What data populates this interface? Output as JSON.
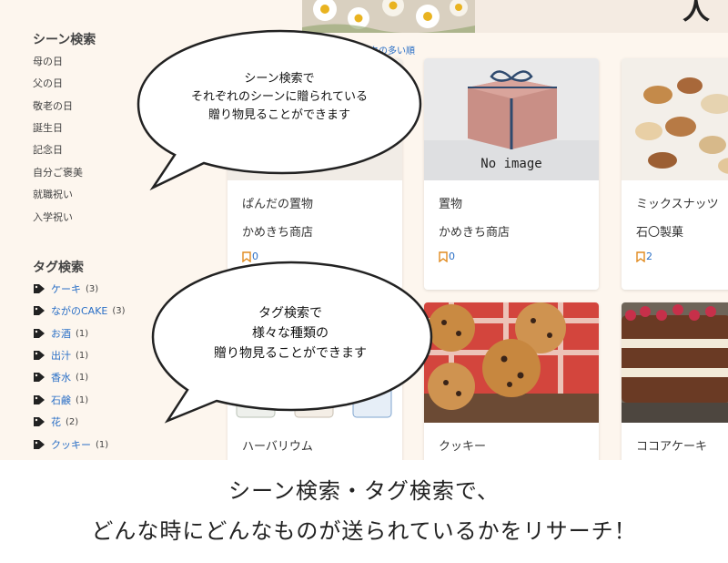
{
  "sidebar": {
    "scene_title": "シーン検索",
    "scenes": [
      "母の日",
      "父の日",
      "敬老の日",
      "誕生日",
      "記念日",
      "自分ご褒美",
      "就職祝い",
      "入学祝い"
    ],
    "tag_title": "タグ検索",
    "tags": [
      {
        "label": "ケーキ",
        "count": "(3)"
      },
      {
        "label": "ながのCAKE",
        "count": "(3)"
      },
      {
        "label": "お酒",
        "count": "(1)"
      },
      {
        "label": "出汁",
        "count": "(1)"
      },
      {
        "label": "香水",
        "count": "(1)"
      },
      {
        "label": "石鹸",
        "count": "(1)"
      },
      {
        "label": "花",
        "count": "(2)"
      },
      {
        "label": "クッキー",
        "count": "(1)"
      }
    ]
  },
  "main": {
    "sort_label": "ークの多い順",
    "hero_title": "人",
    "cards": [
      {
        "name": "ぱんだの置物",
        "shop": "かめきち商店",
        "bookmarks": "0"
      },
      {
        "name": "置物",
        "shop": "かめきち商店",
        "bookmarks": "0",
        "image_text": "No image"
      },
      {
        "name": "ミックスナッツ",
        "shop": "石〇製菓",
        "bookmarks": "2"
      },
      {
        "name": "ハーバリウム"
      },
      {
        "name": "クッキー"
      },
      {
        "name": "ココアケーキ"
      }
    ]
  },
  "bubbles": {
    "scene": [
      "シーン検索で",
      "それぞれのシーンに贈られている",
      "贈り物見ることができます"
    ],
    "tag": [
      "タグ検索で",
      "様々な種類の",
      "贈り物見ることができます"
    ]
  },
  "caption": {
    "line1": "シーン検索・タグ検索で、",
    "line2": "どんな時にどんなものが送られているかをリサーチ！"
  },
  "colors": {
    "link": "#2a6fc6",
    "background": "#fdf6ee",
    "bookmark": "#e08a1e"
  }
}
